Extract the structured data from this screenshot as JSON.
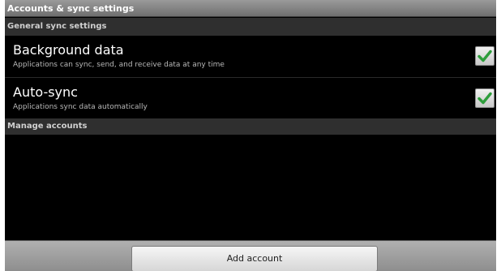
{
  "title_bar": {
    "title": "Accounts & sync settings"
  },
  "general_section": {
    "header": "General sync settings"
  },
  "preferences": [
    {
      "title": "Background data",
      "summary": "Applications can sync, send, and receive data at any time",
      "checked": true
    },
    {
      "title": "Auto-sync",
      "summary": "Applications sync data automatically",
      "checked": true
    }
  ],
  "manage_section": {
    "header": "Manage accounts"
  },
  "bottom_bar": {
    "add_account_label": "Add account"
  },
  "colors": {
    "check_green": "#2e9e3c",
    "background": "#000000",
    "section_header": "#2f2f2f"
  },
  "icons": {
    "checkbox_check": "checkmark-icon"
  }
}
